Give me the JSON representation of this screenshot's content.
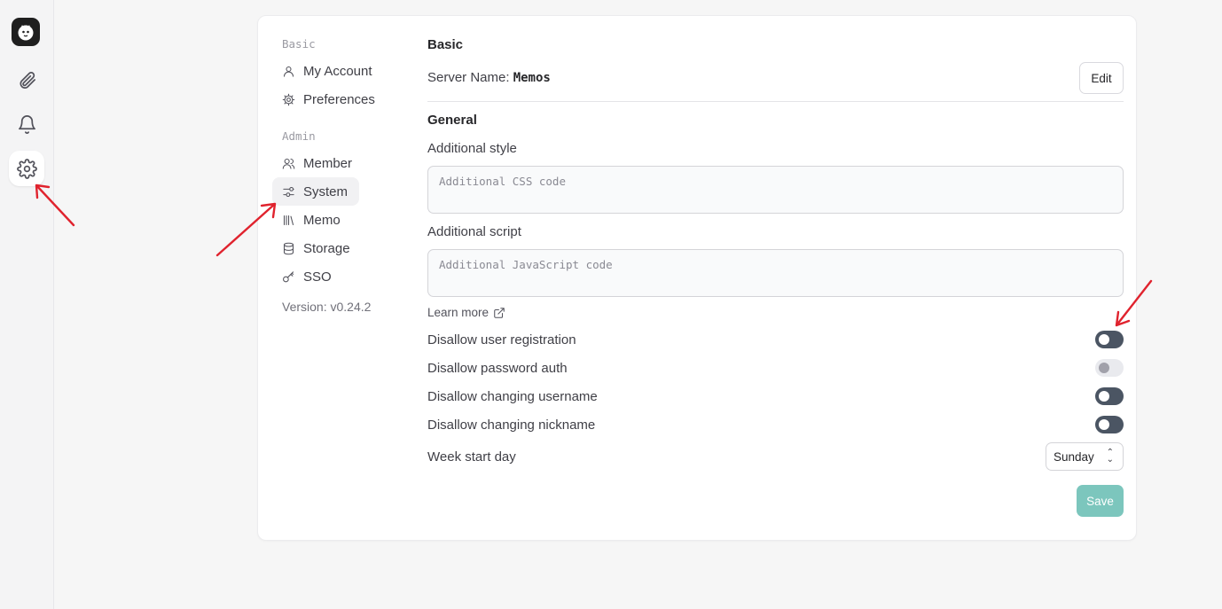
{
  "rail": {
    "items": [
      {
        "icon": "paperclip-icon"
      },
      {
        "icon": "bell-icon"
      },
      {
        "icon": "gear-icon",
        "active": true
      }
    ]
  },
  "nav": {
    "groups": [
      "Basic",
      "Admin"
    ],
    "items": [
      {
        "label": "My Account",
        "icon": "user-icon"
      },
      {
        "label": "Preferences",
        "icon": "cog-icon"
      },
      {
        "label": "Member",
        "icon": "users-icon"
      },
      {
        "label": "System",
        "icon": "sliders-icon",
        "active": true
      },
      {
        "label": "Memo",
        "icon": "library-icon"
      },
      {
        "label": "Storage",
        "icon": "database-icon"
      },
      {
        "label": "SSO",
        "icon": "key-icon"
      }
    ],
    "version": "Version: v0.24.2"
  },
  "basic": {
    "title": "Basic",
    "server_label": "Server Name:",
    "server_value": "Memos",
    "edit_label": "Edit"
  },
  "general": {
    "title": "General",
    "style_label": "Additional style",
    "style_placeholder": "Additional CSS code",
    "script_label": "Additional script",
    "script_placeholder": "Additional JavaScript code",
    "learn_more": "Learn more",
    "toggles": [
      {
        "label": "Disallow user registration",
        "on": false
      },
      {
        "label": "Disallow password auth",
        "on": false,
        "disabled": true
      },
      {
        "label": "Disallow changing username",
        "on": false
      },
      {
        "label": "Disallow changing nickname",
        "on": false
      }
    ],
    "week_start_label": "Week start day",
    "week_start_value": "Sunday",
    "save_label": "Save"
  },
  "colors": {
    "accent": "#7cc6bd",
    "annotation_arrow": "#e0232e",
    "toggle_track": "#4b5563"
  }
}
